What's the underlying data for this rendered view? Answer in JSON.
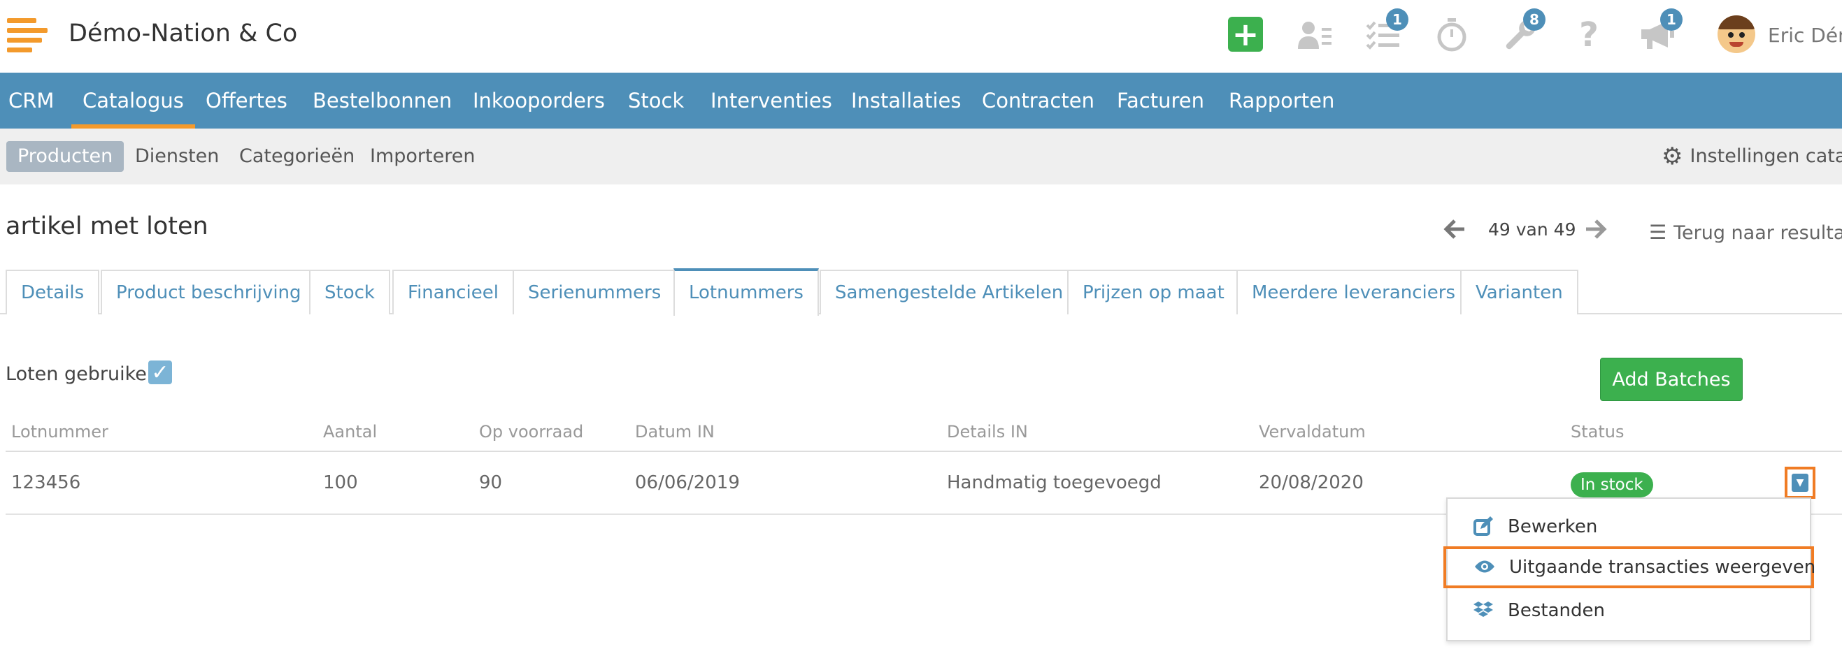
{
  "header": {
    "company": "Démo-Nation & Co",
    "user_name": "Eric Démo",
    "icons": [
      {
        "name": "plus-icon",
        "badge": ""
      },
      {
        "name": "contacts-icon",
        "badge": ""
      },
      {
        "name": "tasks-icon",
        "badge": "1"
      },
      {
        "name": "stopwatch-icon",
        "badge": ""
      },
      {
        "name": "wrench-icon",
        "badge": "8"
      },
      {
        "name": "help-icon",
        "badge": ""
      },
      {
        "name": "megaphone-icon",
        "badge": "1"
      }
    ]
  },
  "mainnav": {
    "items": [
      "CRM",
      "Catalogus",
      "Offertes",
      "Bestelbonnen",
      "Inkooporders",
      "Stock",
      "Interventies",
      "Installaties",
      "Contracten",
      "Facturen",
      "Rapporten"
    ],
    "active": "Catalogus"
  },
  "subnav": {
    "items": [
      "Producten",
      "Diensten",
      "Categorieën",
      "Importeren"
    ],
    "active": "Producten",
    "settings_label": "Instellingen catalogus"
  },
  "page": {
    "title": "artikel met loten",
    "pager": "49 van 49",
    "back_label": "Terug naar resultaten"
  },
  "tabs": {
    "items": [
      "Details",
      "Product beschrijving",
      "Stock",
      "Financieel",
      "Serienummers",
      "Lotnummers",
      "Samengestelde Artikelen",
      "Prijzen op maat",
      "Meerdere leveranciers",
      "Varianten"
    ],
    "active": "Lotnummers"
  },
  "lots": {
    "use_label": "Loten gebruiken",
    "use_checked": true,
    "add_button": "Add Batches",
    "columns": [
      "Lotnummer",
      "Aantal",
      "Op voorraad",
      "Datum IN",
      "Details IN",
      "Vervaldatum",
      "Status"
    ],
    "rows": [
      {
        "lotnummer": "123456",
        "aantal": "100",
        "op_voorraad": "90",
        "datum_in": "06/06/2019",
        "details_in": "Handmatig toegevoegd",
        "vervaldatum": "20/08/2020",
        "status": "In stock"
      }
    ]
  },
  "row_menu": {
    "items": [
      {
        "label": "Bewerken",
        "icon": "edit-icon"
      },
      {
        "label": "Uitgaande transacties weergeven",
        "icon": "eye-icon"
      },
      {
        "label": "Bestanden",
        "icon": "dropbox-icon"
      }
    ]
  },
  "colors": {
    "brand_blue": "#4e8fb8",
    "accent_orange": "#f39a2c",
    "success_green": "#3cb04e",
    "highlight_orange": "#f07c24"
  }
}
